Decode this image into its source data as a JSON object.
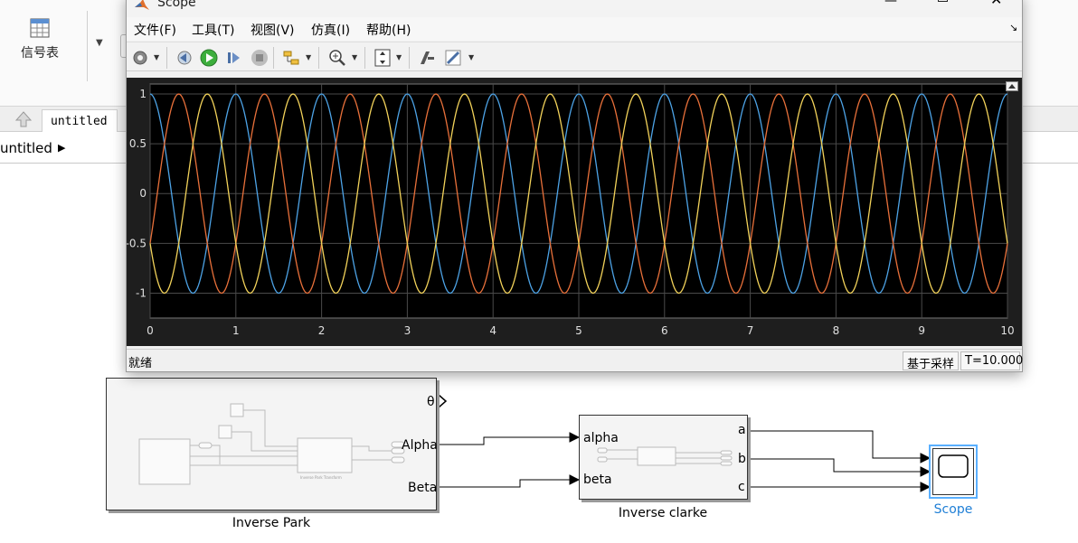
{
  "simulink": {
    "ribbon": {
      "signal_table_label": "信号表"
    },
    "tab": {
      "label": "untitled"
    },
    "breadcrumb": {
      "label": "untitled"
    },
    "blocks": {
      "inverse_park": {
        "name": "Inverse Park",
        "ports_out": [
          "θ",
          "Alpha",
          "Beta"
        ],
        "inner_caption": "Inverse Park Transform"
      },
      "inverse_clarke": {
        "name": "Inverse clarke",
        "ports_in": [
          "alpha",
          "beta"
        ],
        "ports_out": [
          "a",
          "b",
          "c"
        ]
      },
      "scope": {
        "name": "Scope"
      }
    }
  },
  "scope_window": {
    "title": "Scope",
    "menu": [
      "文件(F)",
      "工具(T)",
      "视图(V)",
      "仿真(I)",
      "帮助(H)"
    ],
    "toolbar_icons": [
      "settings-icon",
      "step-back-icon",
      "run-icon",
      "step-forward-icon",
      "stop-icon",
      "signal-select-icon",
      "zoom-icon",
      "fit-axes-icon",
      "highlight-icon",
      "annotate-icon"
    ],
    "status": {
      "left": "就绪",
      "mode": "基于采样",
      "time": "T=10.000"
    },
    "colors": {
      "background": "#000000",
      "grid": "#4a4a4a",
      "axes_text": "#e0e0e0"
    }
  },
  "chart_data": {
    "type": "line",
    "x_ticks": [
      "0",
      "1",
      "2",
      "3",
      "4",
      "5",
      "6",
      "7",
      "8",
      "9",
      "10"
    ],
    "y_ticks": [
      "1",
      "0.5",
      "0",
      "-0.5",
      "-1"
    ],
    "xlim": [
      0,
      10
    ],
    "ylim": [
      -1.25,
      1.1
    ],
    "grid": true,
    "frequency_hz": 1,
    "series": [
      {
        "color": "#4da3e6",
        "phase_deg": 90,
        "amplitude": 1
      },
      {
        "color": "#e8703a",
        "phase_deg": -30,
        "amplitude": 1
      },
      {
        "color": "#f2d25a",
        "phase_deg": 210,
        "amplitude": 1
      }
    ]
  }
}
